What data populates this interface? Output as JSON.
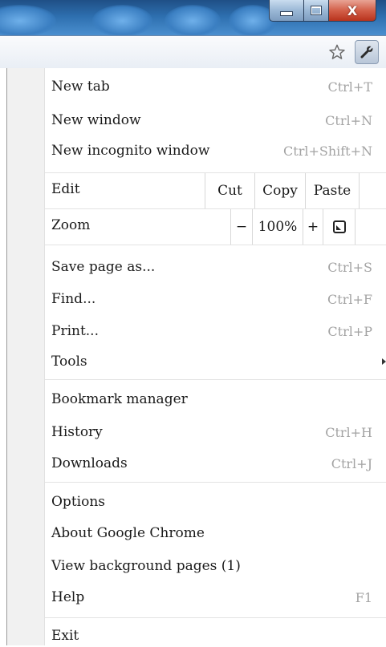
{
  "window": {
    "minimize_icon": "minimize-icon",
    "maximize_icon": "maximize-icon",
    "close_icon": "close-icon",
    "close_glyph": "X",
    "colors": {
      "titlebar": "#2d6eae",
      "close": "#c9462d"
    }
  },
  "toolbar": {
    "star_icon": "bookmark-star-icon",
    "wrench_icon": "wrench-icon"
  },
  "menu": {
    "new_tab": {
      "label": "New tab",
      "shortcut": "Ctrl+T"
    },
    "new_window": {
      "label": "New window",
      "shortcut": "Ctrl+N"
    },
    "new_incognito": {
      "label": "New incognito window",
      "shortcut": "Ctrl+Shift+N"
    },
    "edit": {
      "label": "Edit",
      "cut": "Cut",
      "copy": "Copy",
      "paste": "Paste"
    },
    "zoom": {
      "label": "Zoom",
      "minus": "−",
      "level": "100%",
      "plus": "+",
      "fullscreen_icon": "fullscreen-icon"
    },
    "save_page": {
      "label": "Save page as...",
      "shortcut": "Ctrl+S"
    },
    "find": {
      "label": "Find...",
      "shortcut": "Ctrl+F"
    },
    "print": {
      "label": "Print...",
      "shortcut": "Ctrl+P"
    },
    "tools": {
      "label": "Tools",
      "arrow_icon": "submenu-arrow-icon"
    },
    "bookmark_manager": {
      "label": "Bookmark manager"
    },
    "history": {
      "label": "History",
      "shortcut": "Ctrl+H"
    },
    "downloads": {
      "label": "Downloads",
      "shortcut": "Ctrl+J"
    },
    "options": {
      "label": "Options"
    },
    "about": {
      "label": "About Google Chrome"
    },
    "background_pages": {
      "label": "View background pages (1)"
    },
    "help": {
      "label": "Help",
      "shortcut": "F1"
    },
    "exit": {
      "label": "Exit"
    }
  }
}
